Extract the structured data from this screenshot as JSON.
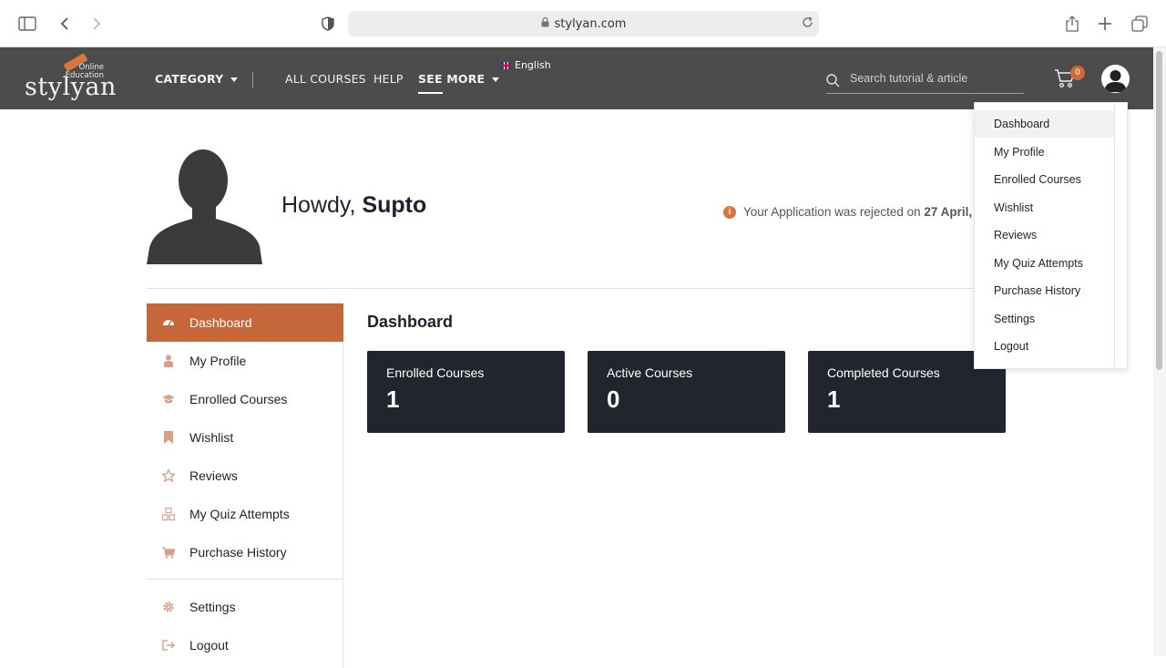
{
  "browser": {
    "url": "stylyan.com"
  },
  "header": {
    "logo_word": "stylyan",
    "logo_sub_1": "Online",
    "logo_sub_2": "Education",
    "nav": {
      "category": "CATEGORY",
      "all_courses": "ALL COURSES",
      "help": "HELP",
      "see_more": "SEE MORE"
    },
    "language": "English",
    "search_placeholder": "Search tutorial & article",
    "cart_count": "0"
  },
  "profile": {
    "greeting": "Howdy,",
    "name": "Supto",
    "notice_text": "Your Application was rejected on",
    "notice_date": "27 April,"
  },
  "sidebar": {
    "items": [
      {
        "label": "Dashboard",
        "icon": "dashboard-icon"
      },
      {
        "label": "My Profile",
        "icon": "user-icon"
      },
      {
        "label": "Enrolled Courses",
        "icon": "graduation-cap-icon"
      },
      {
        "label": "Wishlist",
        "icon": "bookmark-icon"
      },
      {
        "label": "Reviews",
        "icon": "star-icon"
      },
      {
        "label": "My Quiz Attempts",
        "icon": "quiz-icon"
      },
      {
        "label": "Purchase History",
        "icon": "cart-icon"
      },
      {
        "label": "Settings",
        "icon": "gear-icon"
      },
      {
        "label": "Logout",
        "icon": "logout-icon"
      }
    ]
  },
  "main": {
    "title": "Dashboard",
    "stats": [
      {
        "label": "Enrolled Courses",
        "value": "1"
      },
      {
        "label": "Active Courses",
        "value": "0"
      },
      {
        "label": "Completed Courses",
        "value": "1"
      }
    ]
  },
  "dropdown": {
    "items": [
      "Dashboard",
      "My Profile",
      "Enrolled Courses",
      "Wishlist",
      "Reviews",
      "My Quiz Attempts",
      "Purchase History",
      "Settings",
      "Logout"
    ]
  },
  "colors": {
    "accent": "#c6673b",
    "header_bg": "#4c4c4c",
    "card_bg": "#23252e"
  }
}
